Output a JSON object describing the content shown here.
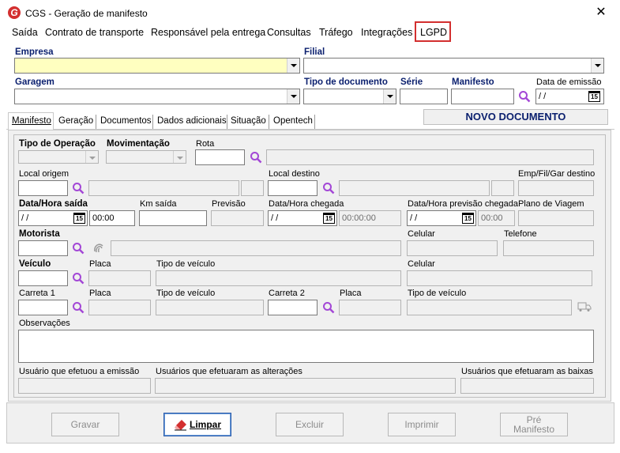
{
  "window": {
    "title": "CGS - Geração de manifesto"
  },
  "menu": [
    "Saída",
    "Contrato de transporte",
    "Responsável pela entrega",
    "Consultas",
    "Tráfego",
    "Integrações",
    "LGPD"
  ],
  "header": {
    "empresa_label": "Empresa",
    "filial_label": "Filial",
    "garagem_label": "Garagem",
    "tipo_documento_label": "Tipo de documento",
    "serie_label": "Série",
    "manifesto_label": "Manifesto",
    "data_emissao_label": "Data de emissão",
    "data_emissao_value": " / /",
    "status": "NOVO DOCUMENTO"
  },
  "tabs": [
    "Manifesto",
    "Geração",
    "Documentos",
    "Dados adicionais",
    "Situação",
    "Opentech"
  ],
  "form": {
    "tipo_operacao": "Tipo de Operação",
    "movimentacao": "Movimentação",
    "rota": "Rota",
    "local_origem": "Local origem",
    "local_destino": "Local destino",
    "emp_fil_gar_destino": "Emp/Fil/Gar destino",
    "data_hora_saida": "Data/Hora saída",
    "data_saida_value": " / /",
    "hora_saida_value": "00:00",
    "km_saida": "Km saída",
    "previsao": "Previsão",
    "data_hora_chegada": "Data/Hora chegada",
    "data_chegada_value": " / /",
    "hora_chegada_value": "00:00:00",
    "data_hora_previsao_chegada": "Data/Hora previsão chegada",
    "data_previsao_value": " / /",
    "hora_previsao_value": "00:00",
    "plano_viagem": "Plano de Viagem",
    "motorista": "Motorista",
    "celular": "Celular",
    "telefone": "Telefone",
    "veiculo": "Veículo",
    "placa": "Placa",
    "tipo_veiculo": "Tipo de veículo",
    "celular2": "Celular",
    "carreta1": "Carreta 1",
    "placa2": "Placa",
    "tipo_veiculo2": "Tipo de veículo",
    "carreta2": "Carreta 2",
    "placa3": "Placa",
    "tipo_veiculo3": "Tipo de veículo",
    "observacoes": "Observações",
    "usuario_emissao": "Usuário que efetuou a emissão",
    "usuarios_alteracoes": "Usuários que efetuaram as alterações",
    "usuarios_baixas": "Usuários que efetuaram as baixas",
    "cal_icon_text": "15"
  },
  "buttons": {
    "gravar": "Gravar",
    "limpar": "Limpar",
    "excluir": "Excluir",
    "imprimir": "Imprimir",
    "pre_manifesto_1": "Pré",
    "pre_manifesto_2": "Manifesto"
  },
  "colors": {
    "accent": "#d32f2f",
    "highlight_field": "#ffffc0",
    "label_blue": "#0a1f6e",
    "search_icon": "#a347d6"
  }
}
